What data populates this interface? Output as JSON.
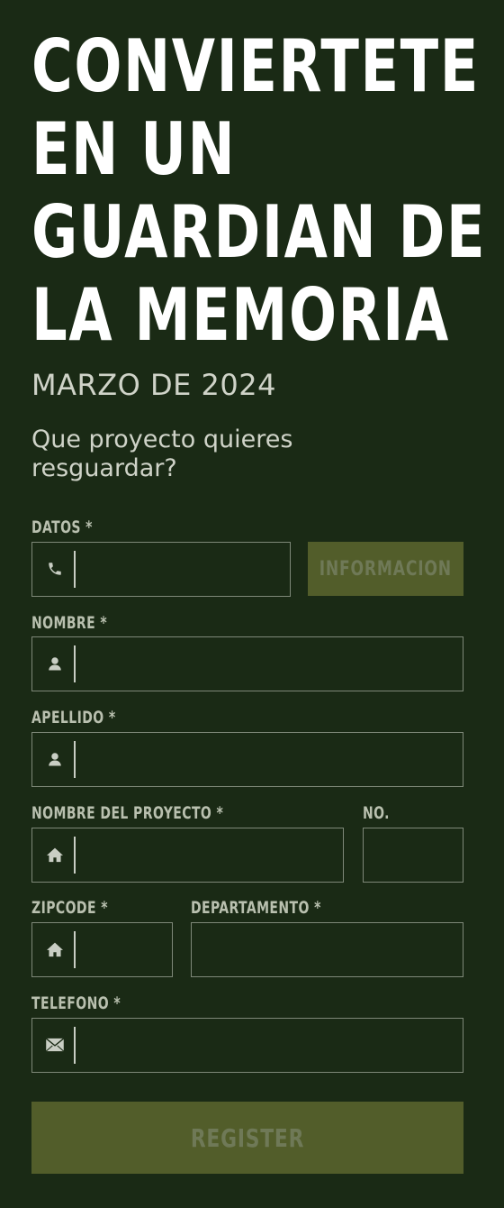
{
  "header": {
    "headline_lines": [
      "CONVIERTETE",
      "EN UN",
      "GUARDIAN DE",
      "LA MEMORIA"
    ],
    "date": "MARZO DE 2024",
    "question": "Que proyecto quieres resguardar?"
  },
  "form": {
    "datos": {
      "label": "DATOS *",
      "icon": "phone-icon",
      "value": "",
      "button_label": "INFORMACION"
    },
    "nombre": {
      "label": "NOMBRE *",
      "icon": "user-icon",
      "value": ""
    },
    "apellido": {
      "label": "APELLIDO *",
      "icon": "user-icon",
      "value": ""
    },
    "nombre_proyecto": {
      "label": "NOMBRE DEL PROYECTO *",
      "icon": "home-icon",
      "value": ""
    },
    "numero": {
      "label": "NO.",
      "value": ""
    },
    "zipcode": {
      "label": "ZIPCODE *",
      "icon": "home-icon",
      "value": ""
    },
    "departamento": {
      "label": "DEPARTAMENTO *",
      "value": ""
    },
    "telefono": {
      "label": "TELEFONO *",
      "icon": "mail-icon",
      "value": ""
    },
    "register_label": "REGISTER"
  },
  "colors": {
    "background": "#1a2a15",
    "button": "#525d2a",
    "button_text": "#6f7957",
    "label": "#b9c0af",
    "border": "#7e8878"
  }
}
